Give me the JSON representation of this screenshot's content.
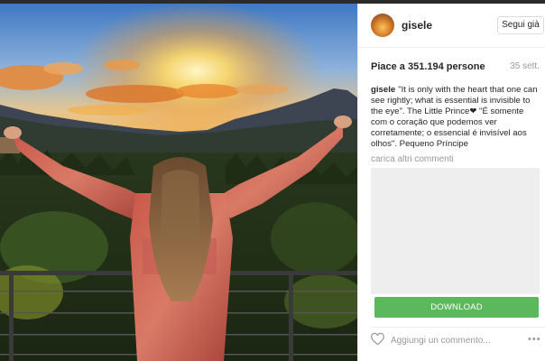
{
  "post": {
    "username": "gisele",
    "follow_label": "Segui già",
    "likes_text": "Piace a 351.194 persone",
    "time_text": "35 sett.",
    "caption_user": "gisele",
    "caption_text": "\"It is only with the heart that one can see rightly; what is essential is invisible to the eye\". The Little Prince❤ \"É somente com o coração que podemos ver corretamente; o essencial é invisível aos olhos\". Pequeno Príncipe",
    "load_more_comments": "carica altri commenti"
  },
  "ad": {
    "download_label": "DOWNLOAD"
  },
  "comment": {
    "placeholder": "Aggiungi un commento..."
  },
  "colors": {
    "download_green": "#5cb85c",
    "panel_bg": "#ffffff",
    "sunset_orange": "#f3a23a"
  },
  "icons": {
    "like": "heart-outline-icon",
    "options": "ellipsis-icon"
  }
}
